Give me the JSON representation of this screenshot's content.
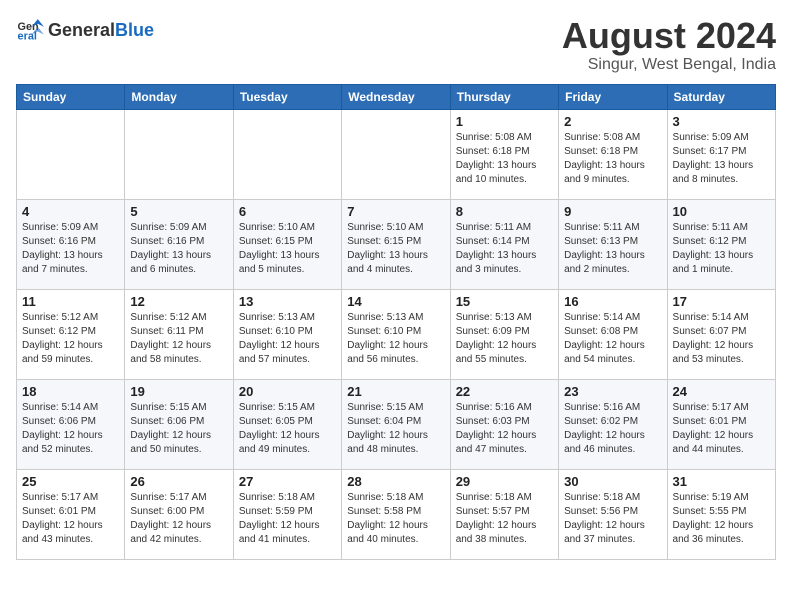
{
  "header": {
    "logo_general": "General",
    "logo_blue": "Blue",
    "title": "August 2024",
    "subtitle": "Singur, West Bengal, India"
  },
  "columns": [
    "Sunday",
    "Monday",
    "Tuesday",
    "Wednesday",
    "Thursday",
    "Friday",
    "Saturday"
  ],
  "weeks": [
    [
      {
        "day": "",
        "info": ""
      },
      {
        "day": "",
        "info": ""
      },
      {
        "day": "",
        "info": ""
      },
      {
        "day": "",
        "info": ""
      },
      {
        "day": "1",
        "info": "Sunrise: 5:08 AM\nSunset: 6:18 PM\nDaylight: 13 hours\nand 10 minutes."
      },
      {
        "day": "2",
        "info": "Sunrise: 5:08 AM\nSunset: 6:18 PM\nDaylight: 13 hours\nand 9 minutes."
      },
      {
        "day": "3",
        "info": "Sunrise: 5:09 AM\nSunset: 6:17 PM\nDaylight: 13 hours\nand 8 minutes."
      }
    ],
    [
      {
        "day": "4",
        "info": "Sunrise: 5:09 AM\nSunset: 6:16 PM\nDaylight: 13 hours\nand 7 minutes."
      },
      {
        "day": "5",
        "info": "Sunrise: 5:09 AM\nSunset: 6:16 PM\nDaylight: 13 hours\nand 6 minutes."
      },
      {
        "day": "6",
        "info": "Sunrise: 5:10 AM\nSunset: 6:15 PM\nDaylight: 13 hours\nand 5 minutes."
      },
      {
        "day": "7",
        "info": "Sunrise: 5:10 AM\nSunset: 6:15 PM\nDaylight: 13 hours\nand 4 minutes."
      },
      {
        "day": "8",
        "info": "Sunrise: 5:11 AM\nSunset: 6:14 PM\nDaylight: 13 hours\nand 3 minutes."
      },
      {
        "day": "9",
        "info": "Sunrise: 5:11 AM\nSunset: 6:13 PM\nDaylight: 13 hours\nand 2 minutes."
      },
      {
        "day": "10",
        "info": "Sunrise: 5:11 AM\nSunset: 6:12 PM\nDaylight: 13 hours\nand 1 minute."
      }
    ],
    [
      {
        "day": "11",
        "info": "Sunrise: 5:12 AM\nSunset: 6:12 PM\nDaylight: 12 hours\nand 59 minutes."
      },
      {
        "day": "12",
        "info": "Sunrise: 5:12 AM\nSunset: 6:11 PM\nDaylight: 12 hours\nand 58 minutes."
      },
      {
        "day": "13",
        "info": "Sunrise: 5:13 AM\nSunset: 6:10 PM\nDaylight: 12 hours\nand 57 minutes."
      },
      {
        "day": "14",
        "info": "Sunrise: 5:13 AM\nSunset: 6:10 PM\nDaylight: 12 hours\nand 56 minutes."
      },
      {
        "day": "15",
        "info": "Sunrise: 5:13 AM\nSunset: 6:09 PM\nDaylight: 12 hours\nand 55 minutes."
      },
      {
        "day": "16",
        "info": "Sunrise: 5:14 AM\nSunset: 6:08 PM\nDaylight: 12 hours\nand 54 minutes."
      },
      {
        "day": "17",
        "info": "Sunrise: 5:14 AM\nSunset: 6:07 PM\nDaylight: 12 hours\nand 53 minutes."
      }
    ],
    [
      {
        "day": "18",
        "info": "Sunrise: 5:14 AM\nSunset: 6:06 PM\nDaylight: 12 hours\nand 52 minutes."
      },
      {
        "day": "19",
        "info": "Sunrise: 5:15 AM\nSunset: 6:06 PM\nDaylight: 12 hours\nand 50 minutes."
      },
      {
        "day": "20",
        "info": "Sunrise: 5:15 AM\nSunset: 6:05 PM\nDaylight: 12 hours\nand 49 minutes."
      },
      {
        "day": "21",
        "info": "Sunrise: 5:15 AM\nSunset: 6:04 PM\nDaylight: 12 hours\nand 48 minutes."
      },
      {
        "day": "22",
        "info": "Sunrise: 5:16 AM\nSunset: 6:03 PM\nDaylight: 12 hours\nand 47 minutes."
      },
      {
        "day": "23",
        "info": "Sunrise: 5:16 AM\nSunset: 6:02 PM\nDaylight: 12 hours\nand 46 minutes."
      },
      {
        "day": "24",
        "info": "Sunrise: 5:17 AM\nSunset: 6:01 PM\nDaylight: 12 hours\nand 44 minutes."
      }
    ],
    [
      {
        "day": "25",
        "info": "Sunrise: 5:17 AM\nSunset: 6:01 PM\nDaylight: 12 hours\nand 43 minutes."
      },
      {
        "day": "26",
        "info": "Sunrise: 5:17 AM\nSunset: 6:00 PM\nDaylight: 12 hours\nand 42 minutes."
      },
      {
        "day": "27",
        "info": "Sunrise: 5:18 AM\nSunset: 5:59 PM\nDaylight: 12 hours\nand 41 minutes."
      },
      {
        "day": "28",
        "info": "Sunrise: 5:18 AM\nSunset: 5:58 PM\nDaylight: 12 hours\nand 40 minutes."
      },
      {
        "day": "29",
        "info": "Sunrise: 5:18 AM\nSunset: 5:57 PM\nDaylight: 12 hours\nand 38 minutes."
      },
      {
        "day": "30",
        "info": "Sunrise: 5:18 AM\nSunset: 5:56 PM\nDaylight: 12 hours\nand 37 minutes."
      },
      {
        "day": "31",
        "info": "Sunrise: 5:19 AM\nSunset: 5:55 PM\nDaylight: 12 hours\nand 36 minutes."
      }
    ]
  ]
}
